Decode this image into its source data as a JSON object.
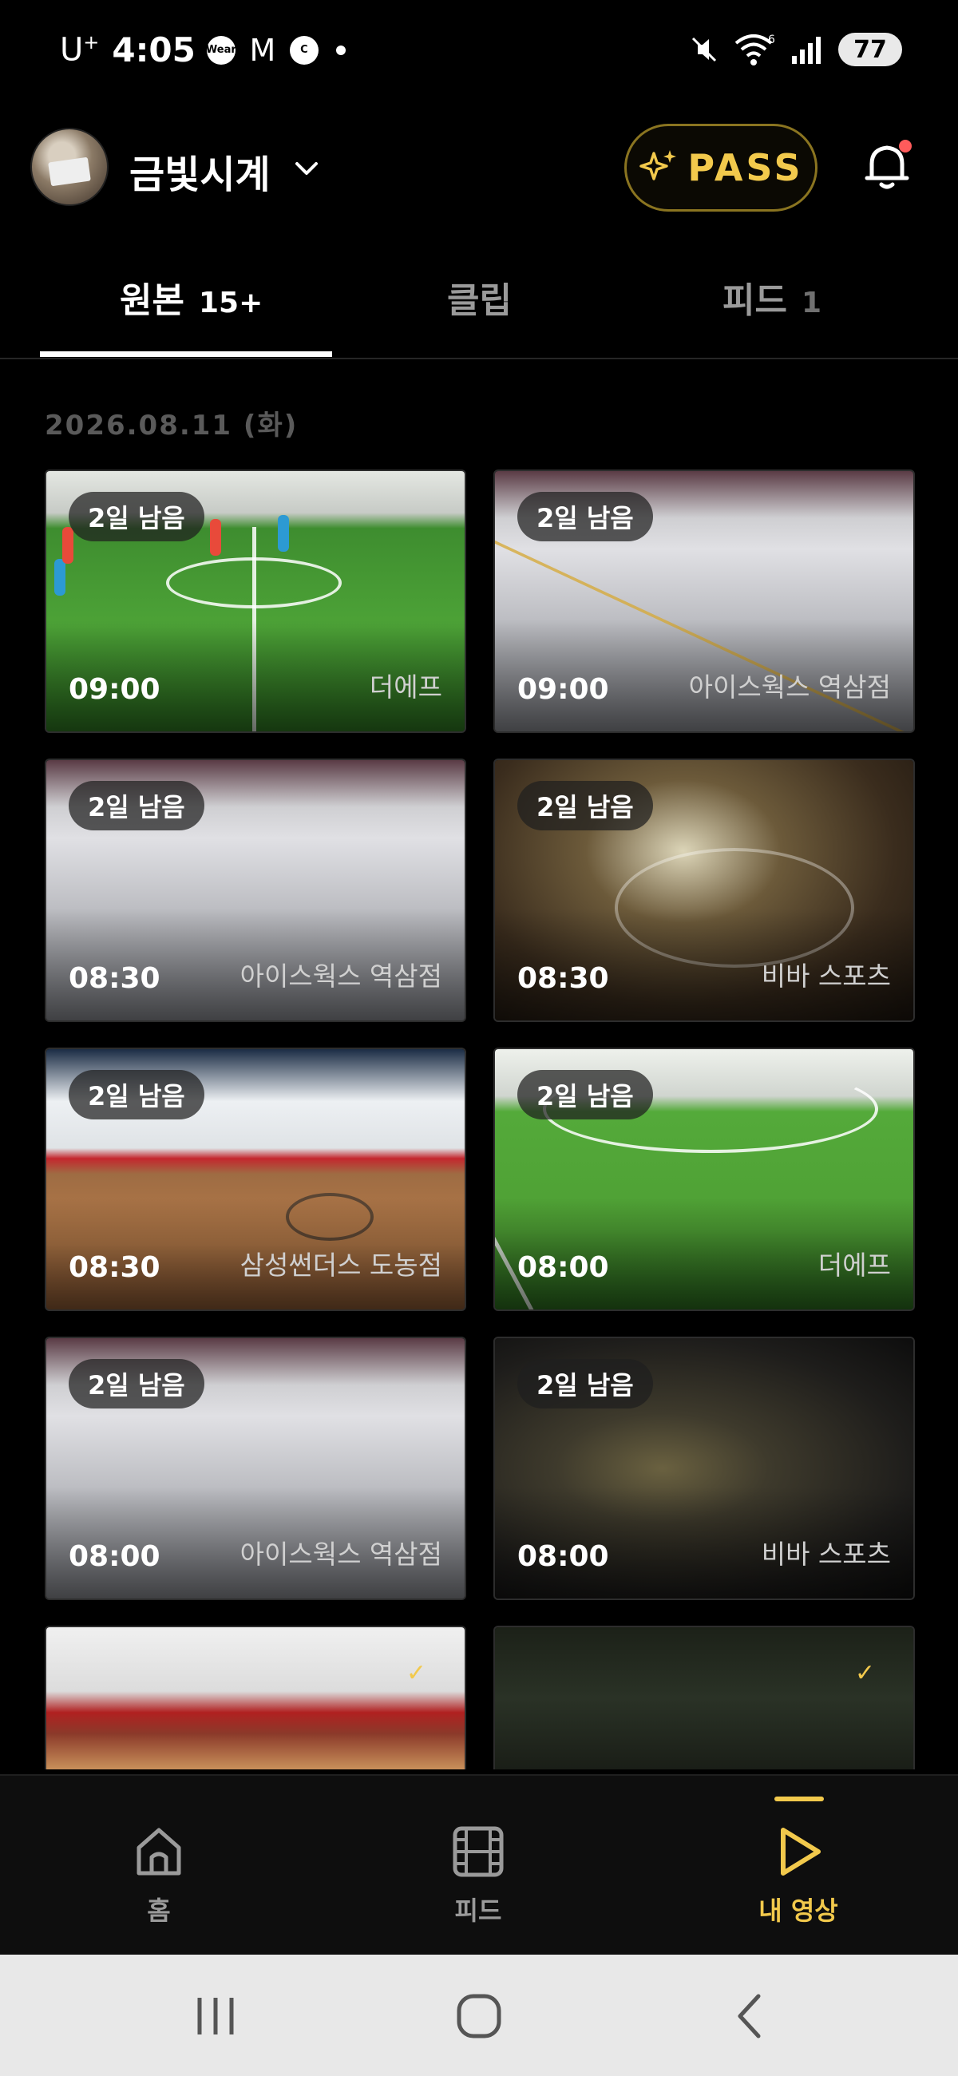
{
  "status_bar": {
    "carrier": "U",
    "carrier_sup": "+",
    "time": "4:05",
    "icons": [
      "wear-icon",
      "gmail-icon",
      "c-icon",
      "dot-icon"
    ],
    "wear_label": "Wear",
    "m_label": "M",
    "c_label": "C",
    "wifi_label": "6",
    "battery": "77"
  },
  "header": {
    "store_name": "금빛시계",
    "pass_label": "PASS"
  },
  "tabs": [
    {
      "label": "원본",
      "count": "15+"
    },
    {
      "label": "클립",
      "count": ""
    },
    {
      "label": "피드",
      "count": "1"
    }
  ],
  "date_label": "2026.08.11 (화)",
  "videos": [
    {
      "remain": "2일 남음",
      "time": "09:00",
      "venue": "더에프"
    },
    {
      "remain": "2일 남음",
      "time": "09:00",
      "venue": "아이스웍스 역삼점"
    },
    {
      "remain": "2일 남음",
      "time": "08:30",
      "venue": "아이스웍스 역삼점"
    },
    {
      "remain": "2일 남음",
      "time": "08:30",
      "venue": "비바 스포츠"
    },
    {
      "remain": "2일 남음",
      "time": "08:30",
      "venue": "삼성썬더스 도농점"
    },
    {
      "remain": "2일 남음",
      "time": "08:00",
      "venue": "더에프"
    },
    {
      "remain": "2일 남음",
      "time": "08:00",
      "venue": "아이스웍스 역삼점"
    },
    {
      "remain": "2일 남음",
      "time": "08:00",
      "venue": "비바 스포츠"
    }
  ],
  "bottom_nav": [
    {
      "label": "홈",
      "icon": "home-icon"
    },
    {
      "label": "피드",
      "icon": "film-icon"
    },
    {
      "label": "내 영상",
      "icon": "play-icon"
    }
  ],
  "colors": {
    "accent": "#f2c94c",
    "background": "#000000",
    "inactive": "#9a9a9a"
  }
}
